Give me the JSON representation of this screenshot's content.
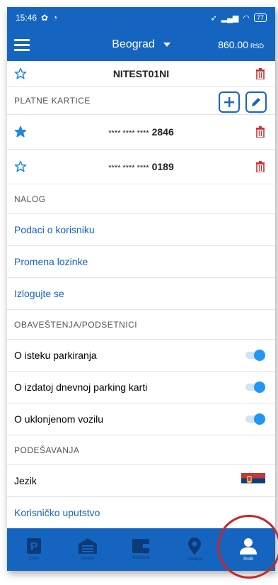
{
  "status_bar": {
    "time": "15:46",
    "battery": "77"
  },
  "header": {
    "city": "Beograd",
    "balance": "860.00",
    "currency": "RSD"
  },
  "vehicle": {
    "plate": "NITEST01NI"
  },
  "cards_section": {
    "title": "PLATNE KARTICE"
  },
  "cards": [
    {
      "mask": "**** **** ****",
      "last4": "2846",
      "favorite": true
    },
    {
      "mask": "**** **** ****",
      "last4": "0189",
      "favorite": false
    }
  ],
  "account_section": {
    "title": "NALOG",
    "items": [
      "Podaci o korisniku",
      "Promena lozinke",
      "Izlogujte se"
    ]
  },
  "notifications_section": {
    "title": "OBAVEŠTENJA/PODSETNICI",
    "items": [
      {
        "label": "O isteku parkiranja",
        "on": true
      },
      {
        "label": "O izdatoj dnevnoj parking karti",
        "on": true
      },
      {
        "label": "O uklonjenom vozilu",
        "on": true
      }
    ]
  },
  "settings_section": {
    "title": "PODEŠAVANJA",
    "language_label": "Jezik",
    "manual_label": "Korisničko uputstvo"
  },
  "nav": [
    {
      "label": "Zone",
      "icon": "parking-icon"
    },
    {
      "label": "Garaže",
      "icon": "garage-icon"
    },
    {
      "label": "Novčanik",
      "icon": "wallet-icon"
    },
    {
      "label": "Lokacije",
      "icon": "location-pin-icon"
    },
    {
      "label": "Profil",
      "icon": "profile-icon",
      "active": true
    }
  ],
  "colors": {
    "primary": "#1565c0",
    "accent": "#2196f3",
    "danger": "#d32f2f",
    "highlight_circle": "#c62828"
  }
}
